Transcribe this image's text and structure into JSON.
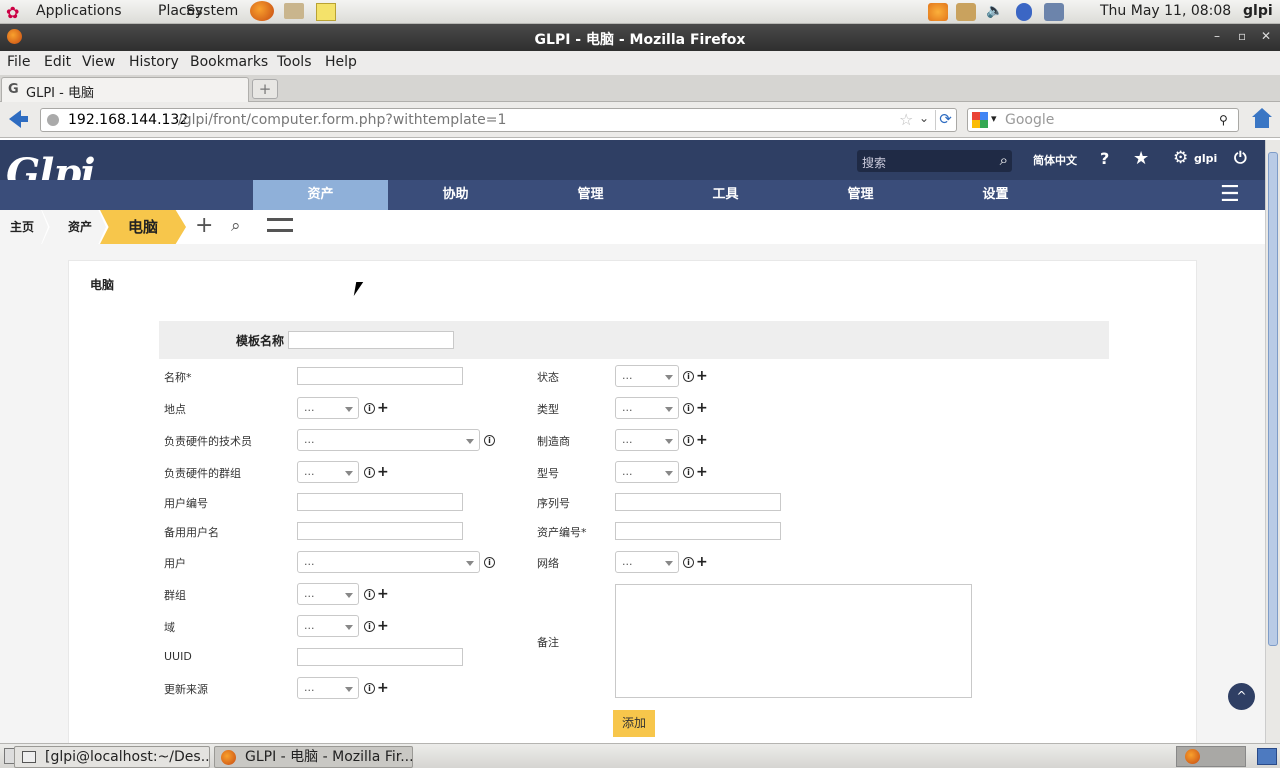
{
  "panel": {
    "applications": "Applications",
    "places": "Places",
    "system": "System",
    "clock": "Thu May 11, 08:08",
    "user": "glpi"
  },
  "window": {
    "title": "GLPI - 电脑 - Mozilla Firefox"
  },
  "menu": [
    "File",
    "Edit",
    "View",
    "History",
    "Bookmarks",
    "Tools",
    "Help"
  ],
  "tab": {
    "label": "GLPI - 电脑"
  },
  "url": {
    "host": "192.168.144.132",
    "path": "/glpi/front/computer.form.php?withtemplate=1"
  },
  "search_placeholder": "Google",
  "glpi": {
    "logo": "Glpi",
    "search_placeholder": "搜索",
    "lang": "简体中文",
    "user": "glpi",
    "menu": [
      "资产",
      "协助",
      "管理",
      "工具",
      "管理",
      "设置"
    ],
    "breadcrumb": [
      "主页",
      "资产",
      "电脑"
    ],
    "card_title": "电脑",
    "template_label": "模板名称",
    "left_labels": [
      "名称*",
      "地点",
      "负责硬件的技术员",
      "负责硬件的群组",
      "用户编号",
      "备用用户名",
      "用户",
      "群组",
      "域",
      "UUID",
      "更新来源"
    ],
    "right_labels": [
      "状态",
      "类型",
      "制造商",
      "型号",
      "序列号",
      "资产编号*",
      "网络",
      "备注"
    ],
    "select_placeholder": "...",
    "add_button": "添加"
  },
  "taskbar": {
    "terminal": "[glpi@localhost:~/Des...",
    "firefox": "GLPI - 电脑 - Mozilla Fir..."
  },
  "colors": {
    "header": "#2f3f64",
    "menu": "#3a4d7a",
    "active_menu": "#8fb0d9",
    "accent": "#f7c64b"
  }
}
